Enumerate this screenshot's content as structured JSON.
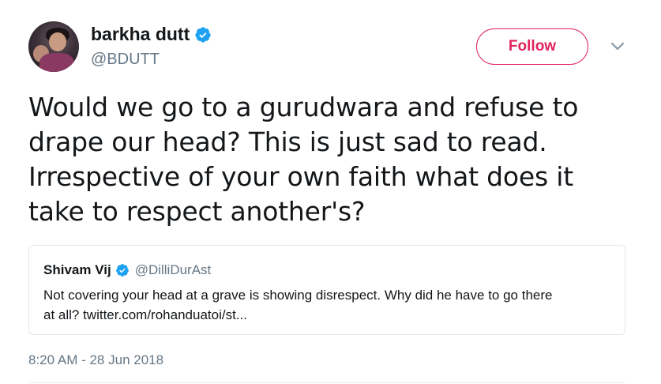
{
  "author": {
    "display_name": "barkha dutt",
    "handle": "@BDUTT",
    "verified": true
  },
  "follow_button": {
    "label": "Follow"
  },
  "tweet": {
    "text_lines": [
      "Would we go to a gurudwara and refuse to",
      "drape our head? This is just sad to read.",
      "Irrespective of your own faith what does it",
      "take to respect another's?"
    ],
    "timestamp": "8:20 AM - 28 Jun 2018"
  },
  "quoted_tweet": {
    "display_name": "Shivam Vij",
    "handle": "@DilliDurAst",
    "verified": true,
    "text_lines": [
      "Not covering your head at a grave is showing disrespect. Why did he have to go there",
      "at all? twitter.com/rohanduatoi/st..."
    ]
  },
  "icons": {
    "verified": "verified-badge-icon",
    "menu": "chevron-down-icon"
  },
  "colors": {
    "follow_accent": "#e0245e",
    "verified_blue": "#1da1f2",
    "secondary_text": "#657786",
    "primary_text": "#14171a",
    "border": "#e1e8ed"
  }
}
